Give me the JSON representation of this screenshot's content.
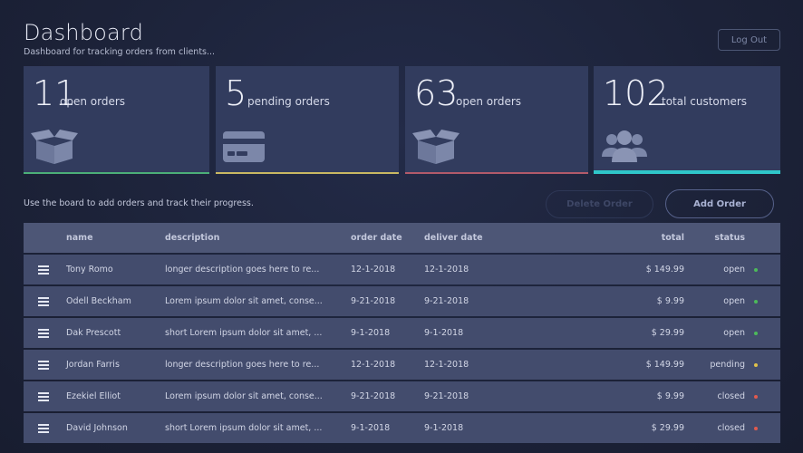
{
  "header": {
    "title": "Dashboard",
    "subtitle": "Dashboard for tracking orders from clients...",
    "logout_label": "Log Out"
  },
  "cards": [
    {
      "value": "11",
      "label": "open orders",
      "icon": "box-icon",
      "accent": "#4caf78"
    },
    {
      "value": "5",
      "label": "pending orders",
      "icon": "credit-card-icon",
      "accent": "#c9b862"
    },
    {
      "value": "63",
      "label": "open orders",
      "icon": "box-icon",
      "accent": "#b25a6a"
    },
    {
      "value": "102",
      "label": "total customers",
      "icon": "users-icon",
      "accent": "#2fc6c9"
    }
  ],
  "toolbar": {
    "instruction": "Use the board to add orders and track their progress.",
    "delete_label": "Delete Order",
    "add_label": "Add Order"
  },
  "table": {
    "headers": {
      "name": "name",
      "description": "description",
      "order_date": "order date",
      "deliver_date": "deliver date",
      "total": "total",
      "status": "status"
    },
    "rows": [
      {
        "name": "Tony Romo",
        "description": "longer description goes here to re...",
        "order_date": "12-1-2018",
        "deliver_date": "12-1-2018",
        "total": "$ 149.99",
        "status": "open",
        "status_color": "#4cba5a"
      },
      {
        "name": "Odell Beckham",
        "description": "Lorem ipsum dolor sit amet, conse...",
        "order_date": "9-21-2018",
        "deliver_date": "9-21-2018",
        "total": "$ 9.99",
        "status": "open",
        "status_color": "#4cba5a"
      },
      {
        "name": "Dak Prescott",
        "description": "short Lorem ipsum dolor sit amet, ...",
        "order_date": "9-1-2018",
        "deliver_date": "9-1-2018",
        "total": "$ 29.99",
        "status": "open",
        "status_color": "#4cba5a"
      },
      {
        "name": "Jordan Farris",
        "description": "longer description goes here to re...",
        "order_date": "12-1-2018",
        "deliver_date": "12-1-2018",
        "total": "$ 149.99",
        "status": "pending",
        "status_color": "#e0c24a"
      },
      {
        "name": "Ezekiel Elliot",
        "description": "Lorem ipsum dolor sit amet, conse...",
        "order_date": "9-21-2018",
        "deliver_date": "9-21-2018",
        "total": "$ 9.99",
        "status": "closed",
        "status_color": "#e05a4e"
      },
      {
        "name": "David Johnson",
        "description": "short Lorem ipsum dolor sit amet, ...",
        "order_date": "9-1-2018",
        "deliver_date": "9-1-2018",
        "total": "$ 29.99",
        "status": "closed",
        "status_color": "#e05a4e"
      }
    ]
  }
}
